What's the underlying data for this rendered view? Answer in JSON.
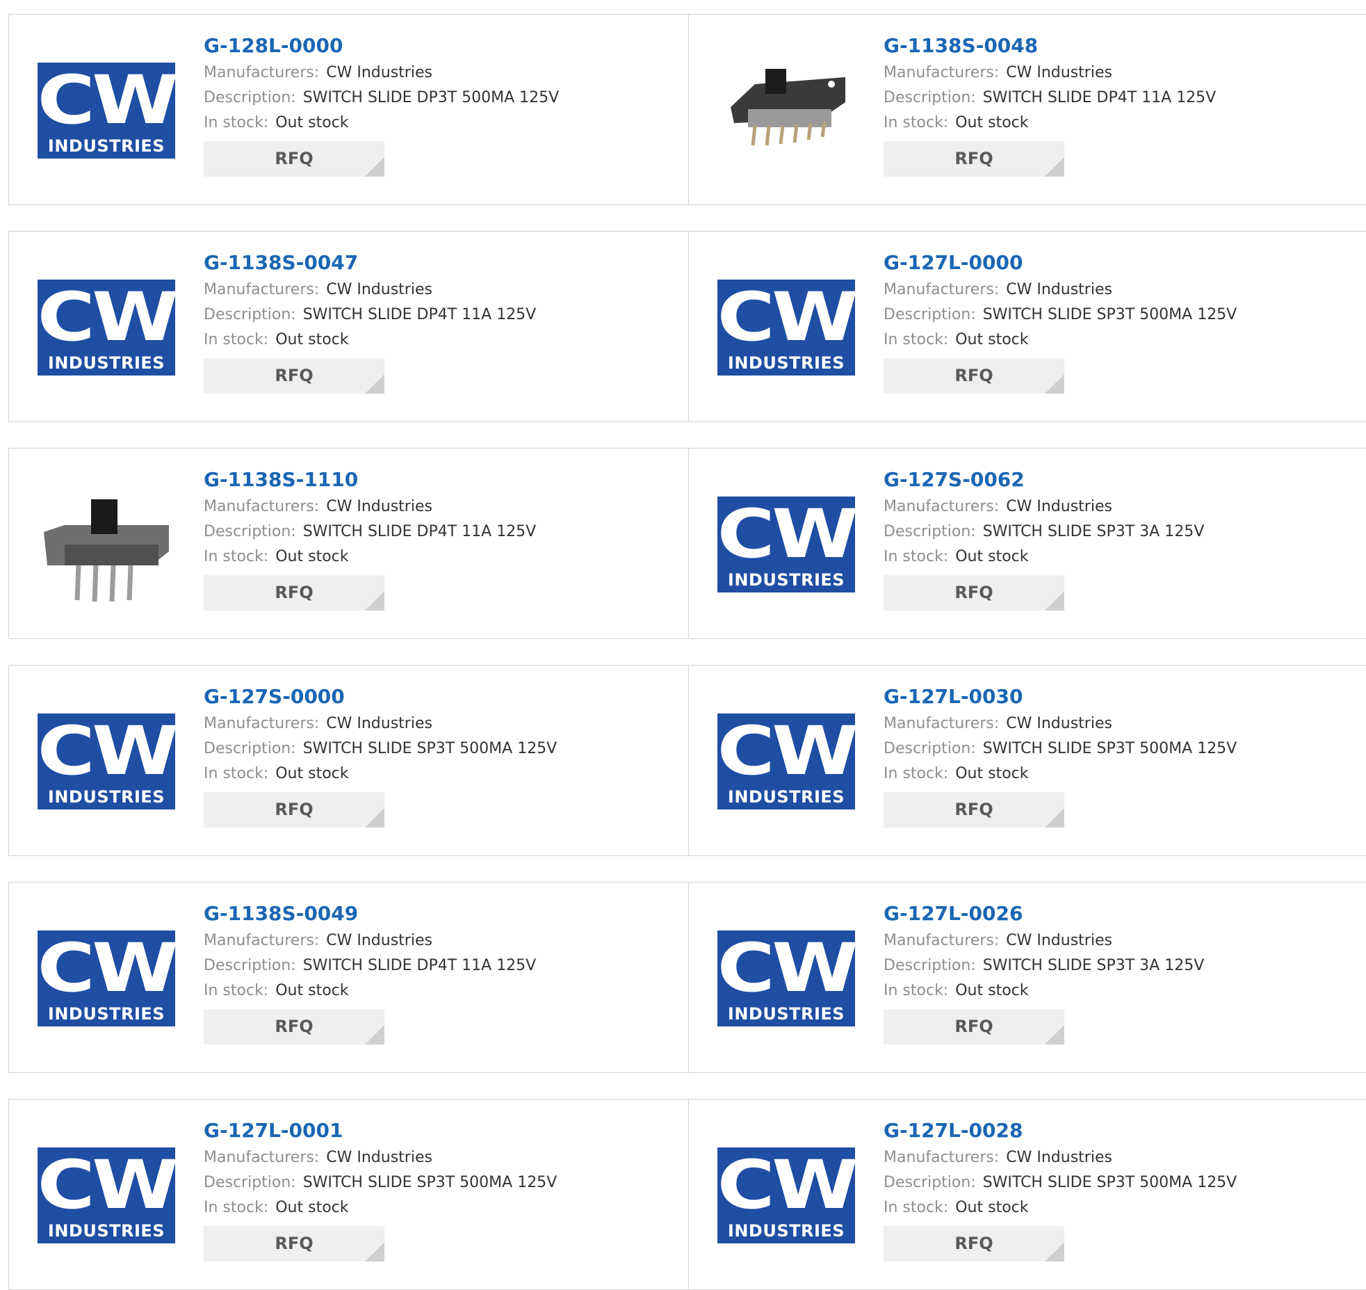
{
  "labels": {
    "manufacturers": "Manufacturers:",
    "description": "Description:",
    "in_stock": "In stock:",
    "rfq": "RFQ"
  },
  "logo": {
    "line1": "CW",
    "line2": "INDUSTRIES"
  },
  "products": [
    {
      "part": "G-128L-0000",
      "manufacturer": "CW Industries",
      "description": "SWITCH SLIDE DP3T 500MA 125V",
      "stock": "Out stock",
      "image": "logo"
    },
    {
      "part": "G-1138S-0048",
      "manufacturer": "CW Industries",
      "description": "SWITCH SLIDE DP4T 11A 125V",
      "stock": "Out stock",
      "image": "photo"
    },
    {
      "part": "G-1138S-0047",
      "manufacturer": "CW Industries",
      "description": "SWITCH SLIDE DP4T 11A 125V",
      "stock": "Out stock",
      "image": "logo"
    },
    {
      "part": "G-127L-0000",
      "manufacturer": "CW Industries",
      "description": "SWITCH SLIDE SP3T 500MA 125V",
      "stock": "Out stock",
      "image": "logo"
    },
    {
      "part": "G-1138S-1110",
      "manufacturer": "CW Industries",
      "description": "SWITCH SLIDE DP4T 11A 125V",
      "stock": "Out stock",
      "image": "photo"
    },
    {
      "part": "G-127S-0062",
      "manufacturer": "CW Industries",
      "description": "SWITCH SLIDE SP3T 3A 125V",
      "stock": "Out stock",
      "image": "logo"
    },
    {
      "part": "G-127S-0000",
      "manufacturer": "CW Industries",
      "description": "SWITCH SLIDE SP3T 500MA 125V",
      "stock": "Out stock",
      "image": "logo"
    },
    {
      "part": "G-127L-0030",
      "manufacturer": "CW Industries",
      "description": "SWITCH SLIDE SP3T 500MA 125V",
      "stock": "Out stock",
      "image": "logo"
    },
    {
      "part": "G-1138S-0049",
      "manufacturer": "CW Industries",
      "description": "SWITCH SLIDE DP4T 11A 125V",
      "stock": "Out stock",
      "image": "logo"
    },
    {
      "part": "G-127L-0026",
      "manufacturer": "CW Industries",
      "description": "SWITCH SLIDE SP3T 3A 125V",
      "stock": "Out stock",
      "image": "logo"
    },
    {
      "part": "G-127L-0001",
      "manufacturer": "CW Industries",
      "description": "SWITCH SLIDE SP3T 500MA 125V",
      "stock": "Out stock",
      "image": "logo"
    },
    {
      "part": "G-127L-0028",
      "manufacturer": "CW Industries",
      "description": "SWITCH SLIDE SP3T 500MA 125V",
      "stock": "Out stock",
      "image": "logo"
    }
  ]
}
